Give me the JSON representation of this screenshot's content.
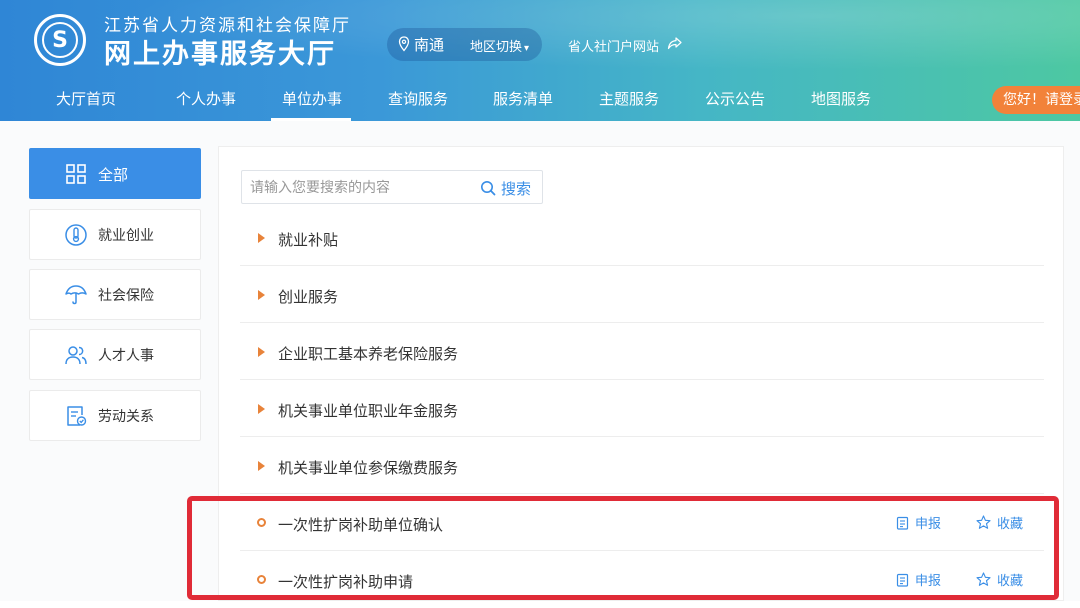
{
  "header": {
    "org_name": "江苏省人力资源和社会保障厅",
    "site_name": "网上办事服务大厅",
    "logo_glyph": "S",
    "region": {
      "name": "南通",
      "switch_label": "地区切换",
      "switch_caret": "▾"
    },
    "portal_link": "省人社门户网站",
    "login_label": "您好！请登录"
  },
  "nav": {
    "items": [
      "大厅首页",
      "个人办事",
      "单位办事",
      "查询服务",
      "服务清单",
      "主题服务",
      "公示公告",
      "地图服务"
    ],
    "active": "单位办事"
  },
  "sidebar": {
    "items": [
      {
        "label": "全部",
        "icon": "grid-icon",
        "active": true
      },
      {
        "label": "就业创业",
        "icon": "thermometer-icon",
        "active": false
      },
      {
        "label": "社会保险",
        "icon": "umbrella-icon",
        "active": false
      },
      {
        "label": "人才人事",
        "icon": "users-icon",
        "active": false
      },
      {
        "label": "劳动关系",
        "icon": "document-icon",
        "active": false
      }
    ]
  },
  "search": {
    "placeholder": "请输入您要搜索的内容",
    "value": "",
    "button_label": "搜索"
  },
  "categories": [
    {
      "label": "就业补贴"
    },
    {
      "label": "创业服务"
    },
    {
      "label": "企业职工基本养老保险服务"
    },
    {
      "label": "机关事业单位职业年金服务"
    },
    {
      "label": "机关事业单位参保缴费服务"
    }
  ],
  "services": [
    {
      "label": "一次性扩岗补助单位确认",
      "apply_label": "申报",
      "favorite_label": "收藏"
    },
    {
      "label": "一次性扩岗补助申请",
      "apply_label": "申报",
      "favorite_label": "收藏"
    }
  ],
  "colors": {
    "accent": "#3a8ee6",
    "orange": "#e8833a",
    "highlight": "#e02b37",
    "login": "#f2823a"
  }
}
